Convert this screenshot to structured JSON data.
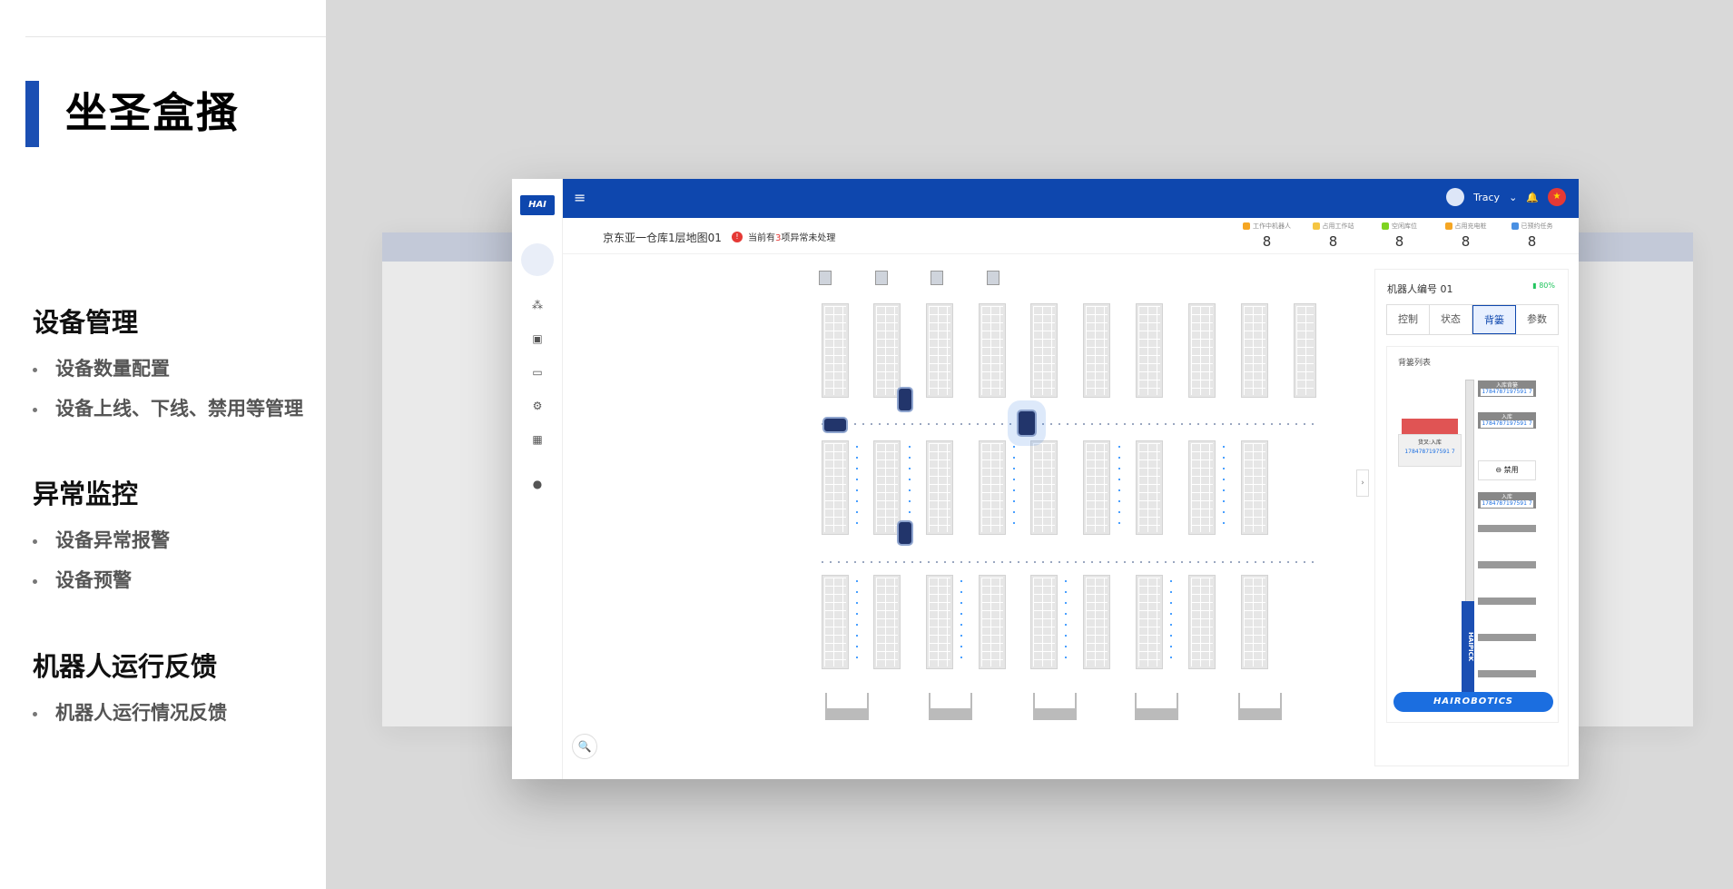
{
  "left": {
    "title": "坐圣盒搔",
    "sections": [
      {
        "heading": "设备管理",
        "items": [
          "设备数量配置",
          "设备上线、下线、禁用等管理"
        ]
      },
      {
        "heading": "异常监控",
        "items": [
          "设备异常报警",
          "设备预警"
        ]
      },
      {
        "heading": "机器人运行反馈",
        "items": [
          "机器人运行情况反馈"
        ]
      }
    ]
  },
  "app": {
    "logo": "HAI",
    "menu_icon": "hamburger-icon",
    "user": "Tracy",
    "map_title": "京东亚一仓库1层地图01",
    "alert": {
      "prefix": "当前有",
      "count": "3",
      "suffix": "项异常未处理"
    },
    "stats": [
      {
        "label": "工作中机器人",
        "value": "8",
        "color": "#f5a623"
      },
      {
        "label": "占用工作站",
        "value": "8",
        "color": "#f5c542"
      },
      {
        "label": "空闲库位",
        "value": "8",
        "color": "#7ed321"
      },
      {
        "label": "占用充电桩",
        "value": "8",
        "color": "#f5a623"
      },
      {
        "label": "已预约任务",
        "value": "8",
        "color": "#4a90e2"
      }
    ],
    "panel": {
      "robot": "机器人编号 01",
      "battery": "80%",
      "tabs": [
        "控制",
        "状态",
        "背篓",
        "参数"
      ],
      "active_tab": "背篓",
      "list_title": "背篓列表",
      "trays": [
        {
          "label": "入库背篓",
          "code": "1784787197591 7"
        },
        {
          "label": "入库",
          "code": "1784787197591 7"
        },
        {
          "label": "入库",
          "code": "1784787197591 7"
        }
      ],
      "red_label": "货叉:入库",
      "red_code": "1784787197591 7",
      "ban": "禁用",
      "brand": "HAIROBOTICS",
      "pole_text": "HAIPICK"
    }
  }
}
